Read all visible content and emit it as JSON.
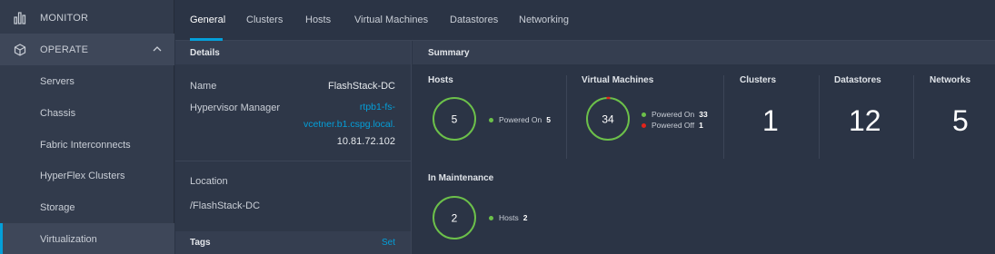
{
  "sidebar": {
    "monitor": {
      "label": "MONITOR",
      "icon": "bar-chart-icon"
    },
    "operate": {
      "label": "OPERATE",
      "icon": "cube-icon"
    },
    "items": [
      {
        "label": "Servers"
      },
      {
        "label": "Chassis"
      },
      {
        "label": "Fabric Interconnects"
      },
      {
        "label": "HyperFlex Clusters"
      },
      {
        "label": "Storage"
      },
      {
        "label": "Virtualization",
        "active": true
      }
    ]
  },
  "tabs": [
    {
      "label": "General",
      "active": true
    },
    {
      "label": "Clusters"
    },
    {
      "label": "Hosts"
    },
    {
      "label": "Virtual Machines"
    },
    {
      "label": "Datastores"
    },
    {
      "label": "Networking"
    }
  ],
  "details": {
    "title": "Details",
    "name_label": "Name",
    "name_value": "FlashStack-DC",
    "hv_label": "Hypervisor Manager",
    "hv_link_line1": "rtpb1-fs-",
    "hv_link_line2": "vcetner.b1.cspg.local.",
    "hv_ip": "10.81.72.102",
    "location_label": "Location",
    "location_value": "/FlashStack-DC",
    "tags_label": "Tags",
    "tags_action": "Set"
  },
  "summary": {
    "title": "Summary",
    "hosts": {
      "title": "Hosts",
      "count": "5",
      "legend_label": "Powered On",
      "legend_value": "5"
    },
    "vms": {
      "title": "Virtual Machines",
      "count": "34",
      "on_label": "Powered On",
      "on_value": "33",
      "off_label": "Powered Off",
      "off_value": "1"
    },
    "clusters": {
      "title": "Clusters",
      "value": "1"
    },
    "datastores": {
      "title": "Datastores",
      "value": "12"
    },
    "networks": {
      "title": "Networks",
      "value": "5"
    },
    "maintenance": {
      "title": "In Maintenance",
      "count": "2",
      "legend_label": "Hosts",
      "legend_value": "2"
    }
  },
  "colors": {
    "accent": "#049fd9",
    "ok": "#6cc04a",
    "error": "#e2231a"
  }
}
